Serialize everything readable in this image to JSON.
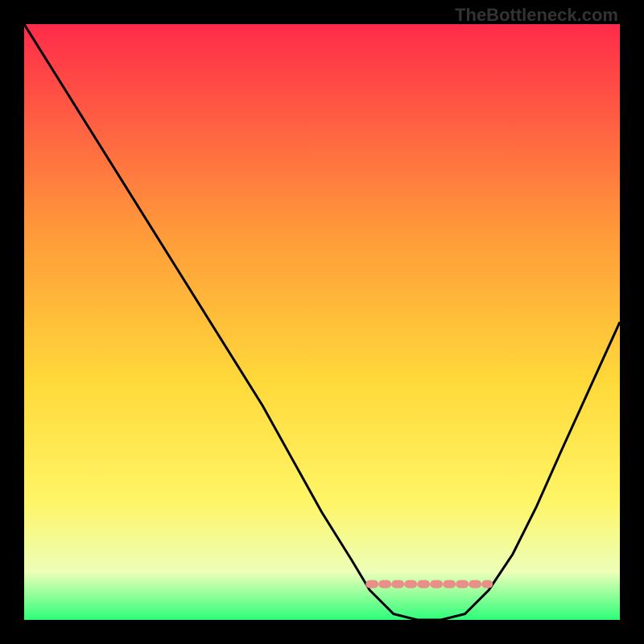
{
  "watermark": "TheBottleneck.com",
  "chart_data": {
    "type": "line",
    "title": "",
    "xlabel": "",
    "ylabel": "",
    "xlim": [
      0,
      100
    ],
    "ylim": [
      0,
      100
    ],
    "gradient_colors": {
      "top": "#ff2b4a",
      "mid1": "#ff7a3a",
      "mid2": "#ffd93a",
      "mid3": "#fff566",
      "mid4": "#ecffb8",
      "bottom": "#2dff7a"
    },
    "curve": [
      {
        "x": 0,
        "y": 100
      },
      {
        "x": 5,
        "y": 92
      },
      {
        "x": 10,
        "y": 84
      },
      {
        "x": 15,
        "y": 76
      },
      {
        "x": 20,
        "y": 68
      },
      {
        "x": 25,
        "y": 60
      },
      {
        "x": 30,
        "y": 52
      },
      {
        "x": 35,
        "y": 44
      },
      {
        "x": 40,
        "y": 36
      },
      {
        "x": 45,
        "y": 27
      },
      {
        "x": 50,
        "y": 18
      },
      {
        "x": 55,
        "y": 10
      },
      {
        "x": 58,
        "y": 5
      },
      {
        "x": 62,
        "y": 1
      },
      {
        "x": 66,
        "y": 0
      },
      {
        "x": 70,
        "y": 0
      },
      {
        "x": 74,
        "y": 1
      },
      {
        "x": 78,
        "y": 5
      },
      {
        "x": 82,
        "y": 11
      },
      {
        "x": 86,
        "y": 19
      },
      {
        "x": 90,
        "y": 28
      },
      {
        "x": 95,
        "y": 39
      },
      {
        "x": 100,
        "y": 50
      }
    ],
    "optimal_band": {
      "x_start": 58,
      "x_end": 78,
      "y": 6,
      "color": "#e89088"
    }
  }
}
